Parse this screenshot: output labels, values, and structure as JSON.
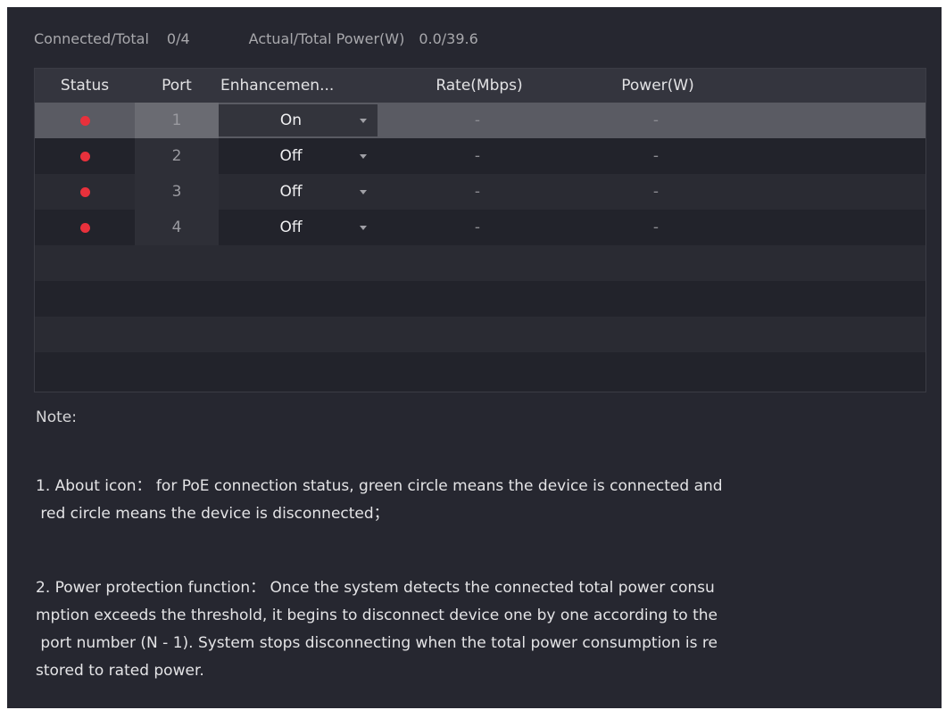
{
  "summary": {
    "connected_label": "Connected/Total",
    "connected_value": "0/4",
    "power_label": "Actual/Total Power(W)",
    "power_value": "0.0/39.6"
  },
  "table": {
    "headers": {
      "status": "Status",
      "port": "Port",
      "enhancement": "Enhancemen...",
      "rate": "Rate(Mbps)",
      "power": "Power(W)"
    },
    "rows": [
      {
        "status": "disconnected",
        "port": "1",
        "enhancement": "On",
        "rate": "-",
        "power": "-"
      },
      {
        "status": "disconnected",
        "port": "2",
        "enhancement": "Off",
        "rate": "-",
        "power": "-"
      },
      {
        "status": "disconnected",
        "port": "3",
        "enhancement": "Off",
        "rate": "-",
        "power": "-"
      },
      {
        "status": "disconnected",
        "port": "4",
        "enhancement": "Off",
        "rate": "-",
        "power": "-"
      }
    ],
    "status_color": "#e8313c"
  },
  "note": {
    "heading": "Note:",
    "item1_lines": [
      "1. About icon： for PoE connection status, green circle means the device is connected and",
      " red circle means the device is disconnected；"
    ],
    "item2_lines": [
      "2. Power protection function： Once the system detects the connected total power consu",
      "mption exceeds the threshold, it begins to disconnect device one by one according to the",
      " port number (N - 1). System stops disconnecting when the total power consumption is re",
      "stored to rated power."
    ]
  }
}
